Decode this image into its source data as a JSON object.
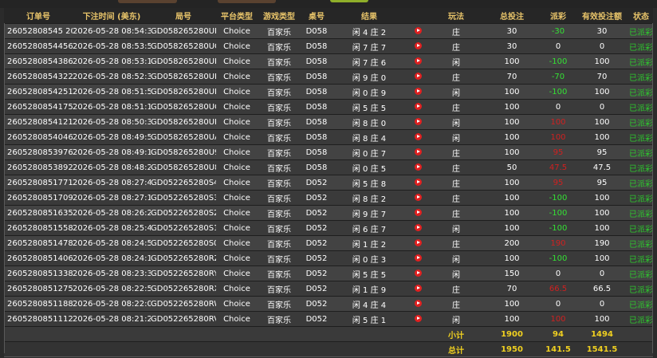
{
  "columns": [
    "订单号",
    "下注时间 (美东)",
    "局号",
    "平台类型",
    "游戏类型",
    "桌号",
    "结果",
    "",
    "玩法",
    "总投注",
    "派彩",
    "有效投注额",
    "状态"
  ],
  "rows": [
    {
      "order": "26052808545 2033",
      "time": "2026-05-28 08:54:36",
      "round": "GD058265280UH",
      "platform": "Choice",
      "game": "百家乐",
      "table": "D058",
      "result": "闲 4 庄 2",
      "play": "庄",
      "bet": "30",
      "payout": "-30",
      "valid": "30",
      "status": "已派彩"
    },
    {
      "order": "260528085445652",
      "time": "2026-05-28 08:53:58",
      "round": "GD058265280UG",
      "platform": "Choice",
      "game": "百家乐",
      "table": "D058",
      "result": "闲 7 庄 7",
      "play": "庄",
      "bet": "30",
      "payout": "0",
      "valid": "0",
      "status": "已派彩"
    },
    {
      "order": "260528085438684",
      "time": "2026-05-28 08:53:18",
      "round": "GD058265280UF",
      "platform": "Choice",
      "game": "百家乐",
      "table": "D058",
      "result": "闲 7 庄 6",
      "play": "闲",
      "bet": "100",
      "payout": "-100",
      "valid": "100",
      "status": "已派彩"
    },
    {
      "order": "260528085432237",
      "time": "2026-05-28 08:52:39",
      "round": "GD058265280UE",
      "platform": "Choice",
      "game": "百家乐",
      "table": "D058",
      "result": "闲 9 庄 0",
      "play": "庄",
      "bet": "70",
      "payout": "-70",
      "valid": "70",
      "status": "已派彩"
    },
    {
      "order": "260528085425107",
      "time": "2026-05-28 08:51:59",
      "round": "GD058265280UD",
      "platform": "Choice",
      "game": "百家乐",
      "table": "D058",
      "result": "闲 0 庄 9",
      "play": "闲",
      "bet": "100",
      "payout": "-100",
      "valid": "100",
      "status": "已派彩"
    },
    {
      "order": "260528085417517",
      "time": "2026-05-28 08:51:12",
      "round": "GD058265280UC",
      "platform": "Choice",
      "game": "百家乐",
      "table": "D058",
      "result": "闲 5 庄 5",
      "play": "庄",
      "bet": "100",
      "payout": "0",
      "valid": "0",
      "status": "已派彩"
    },
    {
      "order": "260528085412186",
      "time": "2026-05-28 08:50:38",
      "round": "GD058265280UB",
      "platform": "Choice",
      "game": "百家乐",
      "table": "D058",
      "result": "闲 8 庄 0",
      "play": "闲",
      "bet": "100",
      "payout": "100",
      "valid": "100",
      "status": "已派彩"
    },
    {
      "order": "260528085404697",
      "time": "2026-05-28 08:49:54",
      "round": "GD058265280UA",
      "platform": "Choice",
      "game": "百家乐",
      "table": "D058",
      "result": "闲 8 庄 4",
      "play": "闲",
      "bet": "100",
      "payout": "100",
      "valid": "100",
      "status": "已派彩"
    },
    {
      "order": "260528085397605",
      "time": "2026-05-28 08:49:12",
      "round": "GD058265280U9",
      "platform": "Choice",
      "game": "百家乐",
      "table": "D058",
      "result": "闲 0 庄 7",
      "play": "庄",
      "bet": "100",
      "payout": "95",
      "valid": "95",
      "status": "已派彩"
    },
    {
      "order": "260528085389217",
      "time": "2026-05-28 08:48:25",
      "round": "GD058265280U8",
      "platform": "Choice",
      "game": "百家乐",
      "table": "D058",
      "result": "闲 0 庄 5",
      "play": "庄",
      "bet": "50",
      "payout": "47.5",
      "valid": "47.5",
      "status": "已派彩"
    },
    {
      "order": "260528085177127",
      "time": "2026-05-28 08:27:47",
      "round": "GD052265280S4",
      "platform": "Choice",
      "game": "百家乐",
      "table": "D052",
      "result": "闲 5 庄 8",
      "play": "庄",
      "bet": "100",
      "payout": "95",
      "valid": "95",
      "status": "已派彩"
    },
    {
      "order": "260528085170997",
      "time": "2026-05-28 08:27:13",
      "round": "GD052265280S3",
      "platform": "Choice",
      "game": "百家乐",
      "table": "D052",
      "result": "闲 8 庄 2",
      "play": "庄",
      "bet": "100",
      "payout": "-100",
      "valid": "100",
      "status": "已派彩"
    },
    {
      "order": "260528085163501",
      "time": "2026-05-28 08:26:28",
      "round": "GD052265280S2",
      "platform": "Choice",
      "game": "百家乐",
      "table": "D052",
      "result": "闲 9 庄 7",
      "play": "庄",
      "bet": "100",
      "payout": "-100",
      "valid": "100",
      "status": "已派彩"
    },
    {
      "order": "260528085155850",
      "time": "2026-05-28 08:25:45",
      "round": "GD052265280S1",
      "platform": "Choice",
      "game": "百家乐",
      "table": "D052",
      "result": "闲 6 庄 7",
      "play": "闲",
      "bet": "100",
      "payout": "-100",
      "valid": "100",
      "status": "已派彩"
    },
    {
      "order": "260528085147871",
      "time": "2026-05-28 08:24:56",
      "round": "GD052265280S0",
      "platform": "Choice",
      "game": "百家乐",
      "table": "D052",
      "result": "闲 1 庄 2",
      "play": "庄",
      "bet": "200",
      "payout": "190",
      "valid": "190",
      "status": "已派彩"
    },
    {
      "order": "260528085140628",
      "time": "2026-05-28 08:24:10",
      "round": "GD052265280RZ",
      "platform": "Choice",
      "game": "百家乐",
      "table": "D052",
      "result": "闲 0 庄 3",
      "play": "闲",
      "bet": "100",
      "payout": "-100",
      "valid": "100",
      "status": "已派彩"
    },
    {
      "order": "260528085133895",
      "time": "2026-05-28 08:23:32",
      "round": "GD052265280RY",
      "platform": "Choice",
      "game": "百家乐",
      "table": "D052",
      "result": "闲 5 庄 5",
      "play": "闲",
      "bet": "150",
      "payout": "0",
      "valid": "0",
      "status": "已派彩"
    },
    {
      "order": "260528085127504",
      "time": "2026-05-28 08:22:53",
      "round": "GD052265280RX",
      "platform": "Choice",
      "game": "百家乐",
      "table": "D052",
      "result": "闲 1 庄 9",
      "play": "庄",
      "bet": "70",
      "payout": "66.5",
      "valid": "66.5",
      "status": "已派彩"
    },
    {
      "order": "260528085118870",
      "time": "2026-05-28 08:22:08",
      "round": "GD052265280RW",
      "platform": "Choice",
      "game": "百家乐",
      "table": "D052",
      "result": "闲 4 庄 4",
      "play": "庄",
      "bet": "100",
      "payout": "0",
      "valid": "0",
      "status": "已派彩"
    },
    {
      "order": "260528085111285",
      "time": "2026-05-28 08:21:21",
      "round": "GD052265280RV",
      "platform": "Choice",
      "game": "百家乐",
      "table": "D052",
      "result": "闲 5 庄 1",
      "play": "闲",
      "bet": "100",
      "payout": "100",
      "valid": "100",
      "status": "已派彩"
    }
  ],
  "subtotal": {
    "label": "小计",
    "bet": "1900",
    "payout": "94",
    "valid": "1494"
  },
  "total": {
    "label": "总计",
    "bet": "1950",
    "payout": "141.5",
    "valid": "1541.5"
  },
  "colors": {
    "header_text": "#e8c46a",
    "win": "#34e034",
    "lose": "#d02020",
    "status": "#2ec82e",
    "footer_text": "#f0d020"
  }
}
